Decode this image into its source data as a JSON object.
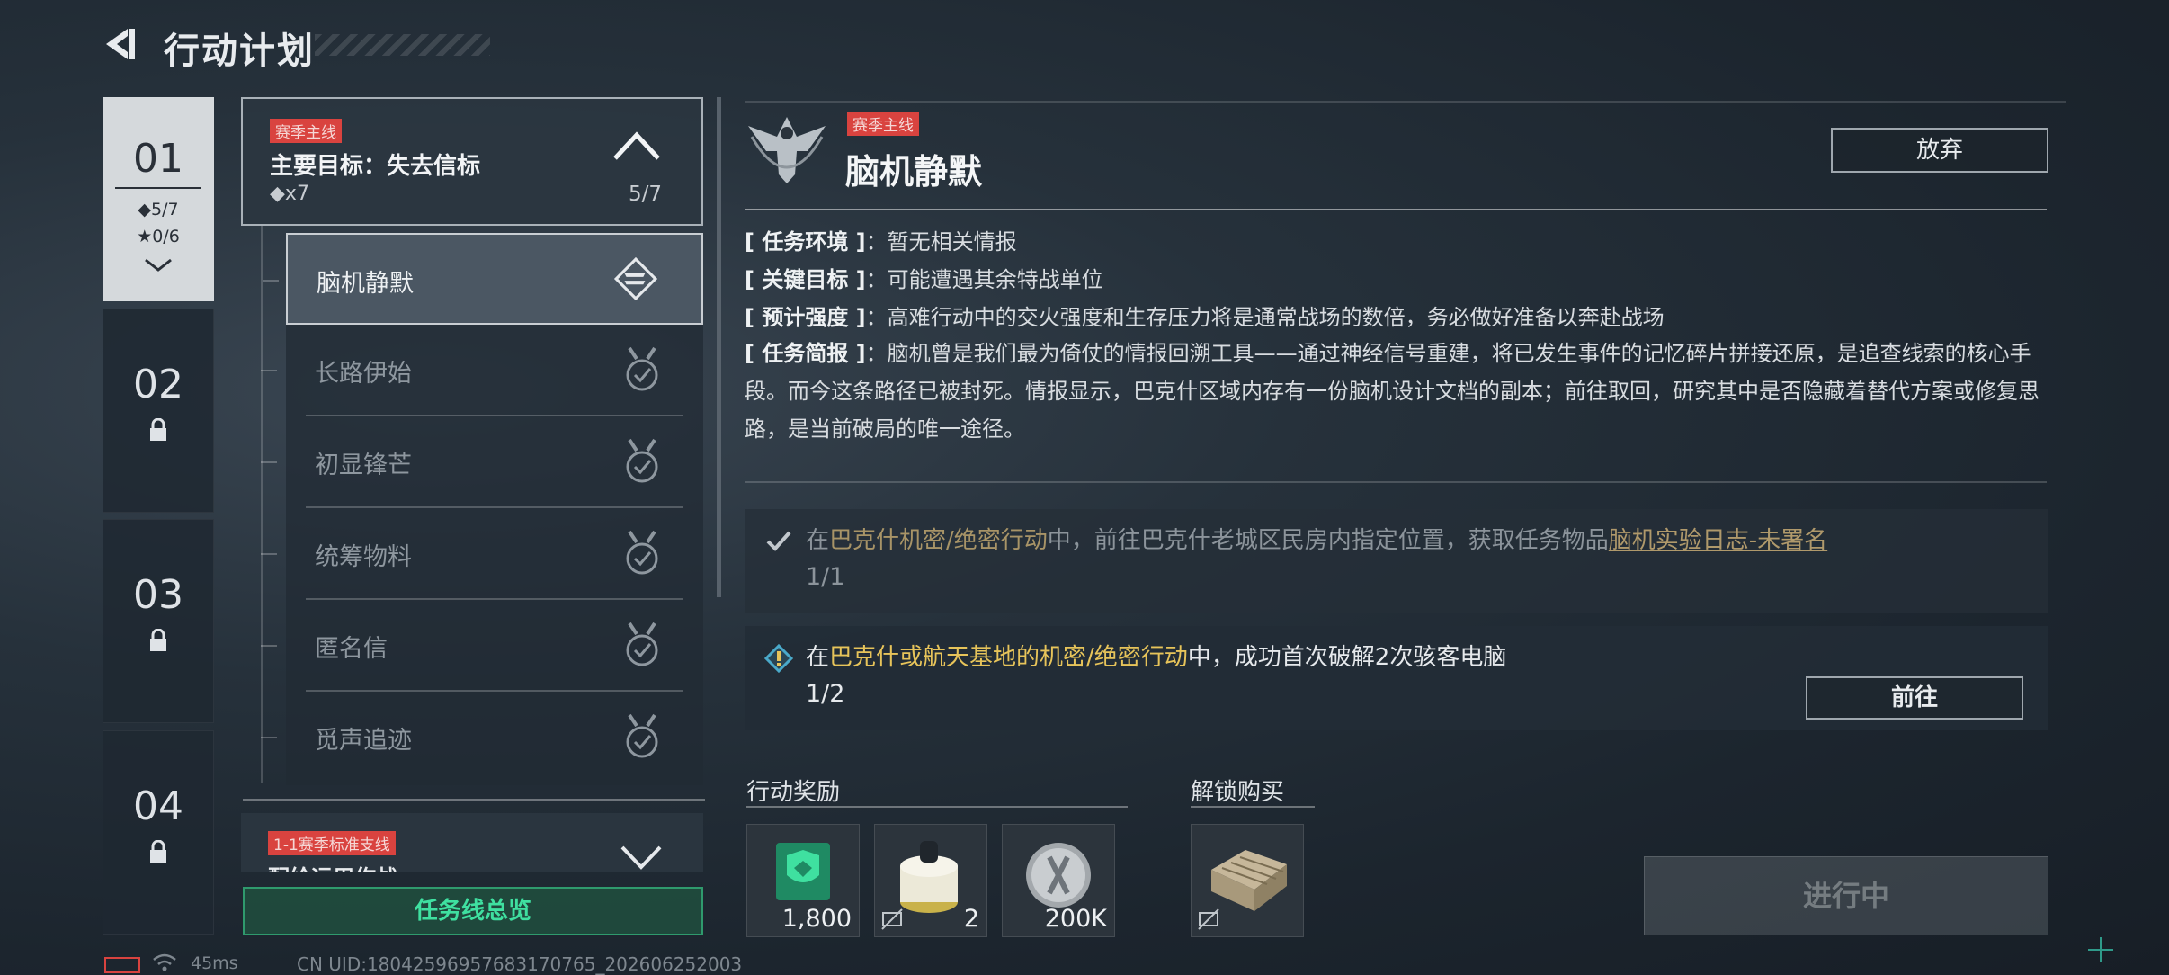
{
  "header": {
    "title": "行动计划"
  },
  "chapters": [
    {
      "num": "01",
      "stat_diamond": "◆5/7",
      "stat_star": "★0/6"
    },
    {
      "num": "02"
    },
    {
      "num": "03"
    },
    {
      "num": "04"
    }
  ],
  "goal": {
    "tag": "赛季主线",
    "title": "主要目标：失去信标",
    "reward": "◆x7",
    "progress": "5/7"
  },
  "missions": [
    {
      "label": "脑机静默"
    },
    {
      "label": "长路伊始"
    },
    {
      "label": "初显锋芒"
    },
    {
      "label": "统筹物料"
    },
    {
      "label": "匿名信"
    },
    {
      "label": "觅声追迹"
    }
  ],
  "branch": {
    "tag": "1-1赛季标准支线",
    "title": "配给运用作战"
  },
  "overview_button": "任务线总览",
  "detail": {
    "tag": "赛季主线",
    "title": "脑机静默",
    "abandon": "放弃",
    "env_key": "[ 任务环境 ]",
    "env_val": "：暂无相关情报",
    "target_key": "[ 关键目标 ]",
    "target_val": "：可能遭遇其余特战单位",
    "strength_key": "[ 预计强度 ]",
    "strength_val": "：高难行动中的交火强度和生存压力将是通常战场的数倍，务必做好准备以奔赴战场",
    "brief_key": "[ 任务简报 ]",
    "brief_val": "：脑机曾是我们最为倚仗的情报回溯工具——通过神经信号重建，将已发生事件的记忆碎片拼接还原，是追查线索的核心手段。而今这条路径已被封死。情报显示，巴克什区域内存有一份脑机设计文档的副本；前往取回，研究其中是否隐藏着替代方案或修复思路，是当前破局的唯一途径。"
  },
  "tasks": [
    {
      "pre": "在",
      "hl": "巴克什机密/绝密行动",
      "mid": "中，前往巴克什老城区民房内指定位置，获取任务物品",
      "link": "脑机实验日志-未署名",
      "progress": "1/1"
    },
    {
      "pre": "在",
      "hl": "巴克什或航天基地的机密/绝密行动",
      "mid": "中，成功首次破解2次骇客电脑",
      "progress": "1/2",
      "button": "前往"
    }
  ],
  "rewards": {
    "title": "行动奖励",
    "items": [
      {
        "amount": "1,800"
      },
      {
        "amount": "2"
      },
      {
        "amount": "200K"
      }
    ]
  },
  "unlock": {
    "title": "解锁购买"
  },
  "status_button": "进行中",
  "footer": {
    "ping": "45ms",
    "uid": "CN UID:18042596957683170765_202606252003"
  },
  "colors": {
    "accent_red": "#d9433f",
    "accent_green": "#3fe0a0",
    "highlight_yellow": "#e7c45a"
  }
}
